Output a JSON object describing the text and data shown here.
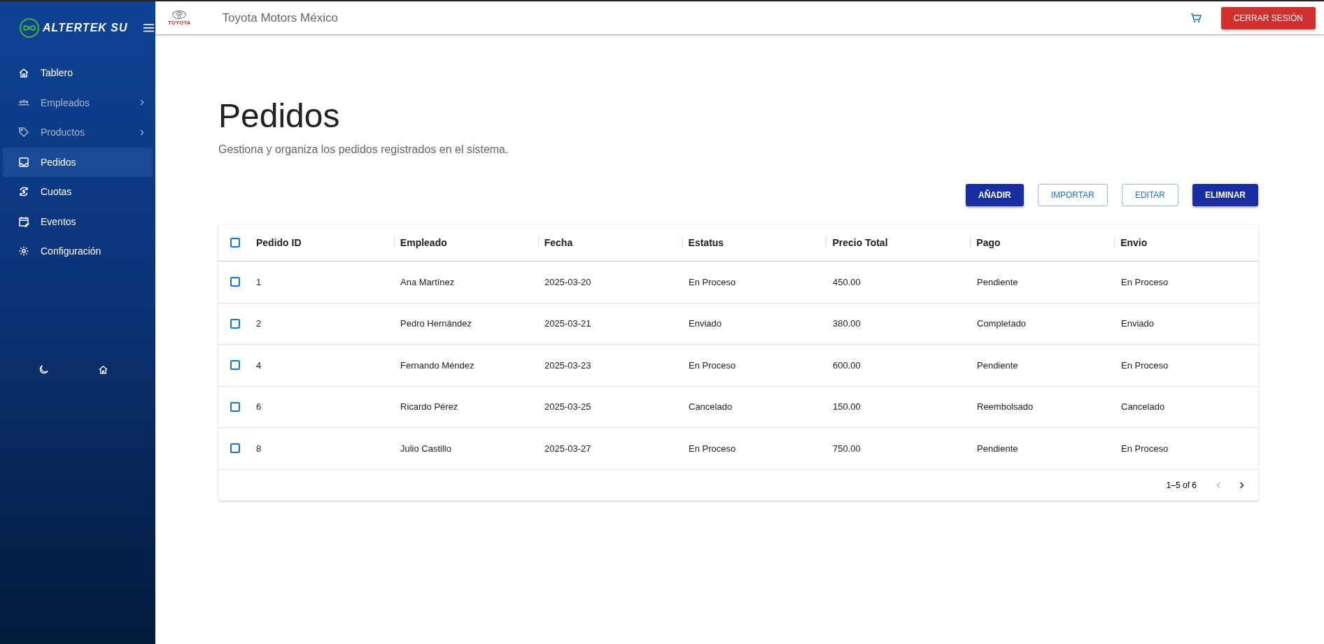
{
  "sidebar": {
    "logo_text": "ALTERTEK SU",
    "items": [
      {
        "label": "Tablero",
        "expandable": false,
        "selected": false
      },
      {
        "label": "Empleados",
        "expandable": true,
        "selected": false
      },
      {
        "label": "Productos",
        "expandable": true,
        "selected": false
      },
      {
        "label": "Pedidos",
        "selected": true,
        "expandable": false
      },
      {
        "label": "Cuotas",
        "expandable": false,
        "selected": false
      },
      {
        "label": "Eventos",
        "expandable": false,
        "selected": false
      },
      {
        "label": "Configuración",
        "expandable": false,
        "selected": false
      }
    ]
  },
  "header": {
    "company": "Toyota Motors México",
    "brand_text": "TOYOTA",
    "logout": "CERRAR SESIÓN"
  },
  "page": {
    "title": "Pedidos",
    "subtitle": "Gestiona y organiza los pedidos registrados en el sistema."
  },
  "actions": [
    {
      "label": "AÑADIR",
      "kind": "filled"
    },
    {
      "label": "IMPORTAR",
      "kind": "outlined"
    },
    {
      "label": "EDITAR",
      "kind": "outlined"
    },
    {
      "label": "ELIMINAR",
      "kind": "filled"
    }
  ],
  "table": {
    "select_all_checked": false,
    "columns": [
      "Pedido ID",
      "Empleado",
      "Fecha",
      "Estatus",
      "Precio Total",
      "Pago",
      "Envio"
    ],
    "rows": [
      {
        "checked": false,
        "cells": [
          "1",
          "Ana Martínez",
          "2025-03-20",
          "En Proceso",
          "450.00",
          "Pendiente",
          "En Proceso"
        ]
      },
      {
        "checked": false,
        "cells": [
          "2",
          "Pedro Hernández",
          "2025-03-21",
          "Enviado",
          "380.00",
          "Completado",
          "Enviado"
        ]
      },
      {
        "checked": false,
        "cells": [
          "4",
          "Fernando Méndez",
          "2025-03-23",
          "En Proceso",
          "600.00",
          "Pendiente",
          "En Proceso"
        ]
      },
      {
        "checked": false,
        "cells": [
          "6",
          "Ricardo Pérez",
          "2025-03-25",
          "Cancelado",
          "150.00",
          "Reembolsado",
          "Cancelado"
        ]
      },
      {
        "checked": false,
        "cells": [
          "8",
          "Julio Castillo",
          "2025-03-27",
          "En Proceso",
          "750.00",
          "Pendiente",
          "En Proceso"
        ]
      }
    ],
    "pagination": {
      "range": "1–5 of 6",
      "prev_disabled": true,
      "next_disabled": false
    }
  }
}
